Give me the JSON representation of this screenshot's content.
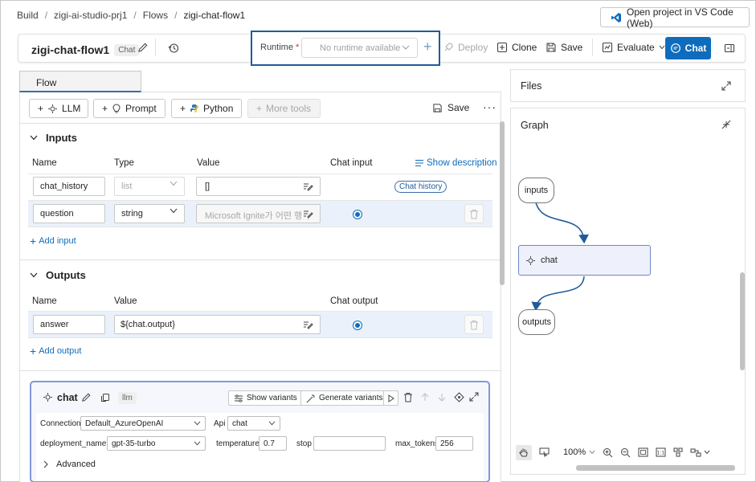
{
  "breadcrumb": {
    "items": [
      "Build",
      "zigi-ai-studio-prj1",
      "Flows",
      "zigi-chat-flow1"
    ]
  },
  "vscode_button": {
    "label": "Open project in VS Code (Web)",
    "icon": "vscode-icon"
  },
  "toolbar": {
    "flow_name": "zigi-chat-flow1",
    "flow_type_chip": "Chat",
    "runtime_label": "Runtime",
    "runtime_required": "*",
    "runtime_placeholder": "No runtime available",
    "deploy_label": "Deploy",
    "clone_label": "Clone",
    "save_label": "Save",
    "evaluate_label": "Evaluate",
    "chat_label": "Chat"
  },
  "tabs": {
    "flow": "Flow"
  },
  "tools": {
    "llm": "LLM",
    "prompt": "Prompt",
    "python": "Python",
    "more_tools": "More tools",
    "save": "Save"
  },
  "inputs": {
    "section_title": "Inputs",
    "show_description": "Show description",
    "headers": {
      "name": "Name",
      "type": "Type",
      "value": "Value",
      "chat_input": "Chat input"
    },
    "rows": [
      {
        "name": "chat_history",
        "type": "list",
        "value": "[]",
        "badge": "Chat history"
      },
      {
        "name": "question",
        "type": "string",
        "value": "Microsoft Ignite가 어떤 행사"
      }
    ],
    "add_label": "Add input"
  },
  "outputs": {
    "section_title": "Outputs",
    "headers": {
      "name": "Name",
      "value": "Value",
      "chat_output": "Chat output"
    },
    "rows": [
      {
        "name": "answer",
        "value": "${chat.output}"
      }
    ],
    "add_label": "Add output"
  },
  "node": {
    "name": "chat",
    "type_chip": "llm",
    "show_variants": "Show variants",
    "generate_variants": "Generate variants",
    "connection_label": "Connection",
    "connection_value": "Default_AzureOpenAI",
    "api_label": "Api",
    "api_value": "chat",
    "deployment_label": "deployment_name",
    "deployment_value": "gpt-35-turbo",
    "temperature_label": "temperature",
    "temperature_value": "0.7",
    "stop_label": "stop",
    "stop_value": "",
    "max_tokens_label": "max_tokens",
    "max_tokens_value": "256",
    "advanced_label": "Advanced"
  },
  "right_panel": {
    "files_title": "Files",
    "graph_title": "Graph",
    "graph_nodes": {
      "inputs": "inputs",
      "chat": "chat",
      "outputs": "outputs"
    },
    "zoom": "100%"
  },
  "colors": {
    "accent": "#0f6cbd",
    "highlight_border": "#1f5c99",
    "node_border": "#7f99d6"
  }
}
